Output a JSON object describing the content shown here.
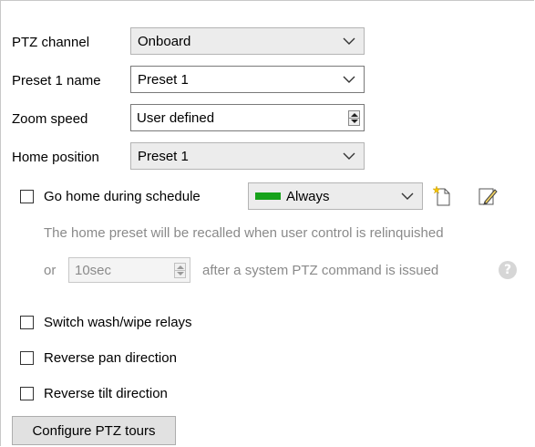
{
  "ptz_channel": {
    "label": "PTZ channel",
    "value": "Onboard"
  },
  "preset1_name": {
    "label": "Preset 1 name",
    "value": "Preset 1"
  },
  "zoom_speed": {
    "label": "Zoom speed",
    "value": "User defined"
  },
  "home_position": {
    "label": "Home position",
    "value": "Preset 1"
  },
  "go_home": {
    "label": "Go home during schedule",
    "checked": false,
    "schedule_value": "Always",
    "schedule_color": "#17a21b",
    "new_icon": "new-schedule-icon",
    "edit_icon": "edit-pencil-icon"
  },
  "info_text": "The home preset will be recalled when user control is relinquished",
  "timeout_row": {
    "or_label": "or",
    "value": "10sec",
    "after_text": "after a system PTZ command is issued",
    "help_icon": "question-icon",
    "help_glyph": "?"
  },
  "checkboxes": [
    {
      "label": "Switch wash/wipe relays",
      "checked": false
    },
    {
      "label": "Reverse pan direction",
      "checked": false
    },
    {
      "label": "Reverse tilt direction",
      "checked": false
    }
  ],
  "configure_button": "Configure PTZ tours"
}
